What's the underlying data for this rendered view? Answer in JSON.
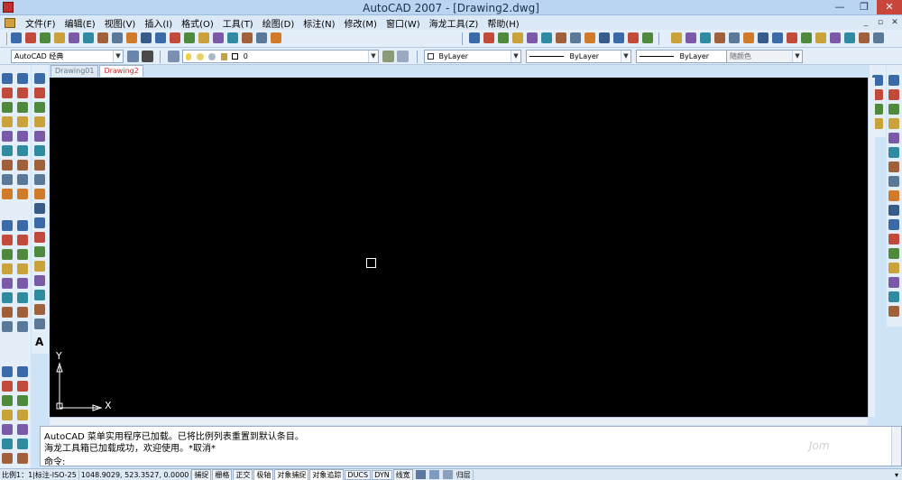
{
  "window": {
    "title": "AutoCAD 2007 - [Drawing2.dwg]",
    "min_glyph": "—",
    "max_glyph": "❐",
    "close_glyph": "✕"
  },
  "menu": {
    "items": [
      "文件(F)",
      "编辑(E)",
      "视图(V)",
      "插入(I)",
      "格式(O)",
      "工具(T)",
      "绘图(D)",
      "标注(N)",
      "修改(M)",
      "窗口(W)",
      "海龙工具(Z)",
      "帮助(H)"
    ],
    "doc_controls": [
      "_",
      "▫",
      "✕"
    ]
  },
  "toolbar2": {
    "workspace": "AutoCAD 经典",
    "layer_value": "0",
    "color_value": "ByLayer",
    "linetype_value": "ByLayer",
    "lineweight_value": "ByLayer",
    "plotstyle_value": "随颜色"
  },
  "tabs": [
    {
      "label": "Drawing01",
      "active": false
    },
    {
      "label": "Drawing2",
      "active": true
    }
  ],
  "canvas": {
    "ucs_x_label": "X",
    "ucs_y_label": "Y"
  },
  "command": {
    "lines": [
      "AutoCAD 菜单实用程序已加载。已将比例列表重置到默认条目。",
      "海龙工具箱已加载成功，欢迎使用。*取消*"
    ],
    "prompt": "命令:",
    "input_value": ""
  },
  "watermark": "Jom",
  "status": {
    "scale": "比例1：1|标注-ISO-25",
    "coords": "1048.9029, 523.3527, 0.0000",
    "buttons": [
      {
        "label": "捕捉",
        "on": false
      },
      {
        "label": "栅格",
        "on": false
      },
      {
        "label": "正交",
        "on": false
      },
      {
        "label": "极轴",
        "on": true
      },
      {
        "label": "对象捕捉",
        "on": true
      },
      {
        "label": "对象追踪",
        "on": true
      },
      {
        "label": "DUCS",
        "on": false
      },
      {
        "label": "DYN",
        "on": false
      },
      {
        "label": "线宽",
        "on": false
      }
    ],
    "layer_label": "归层"
  }
}
